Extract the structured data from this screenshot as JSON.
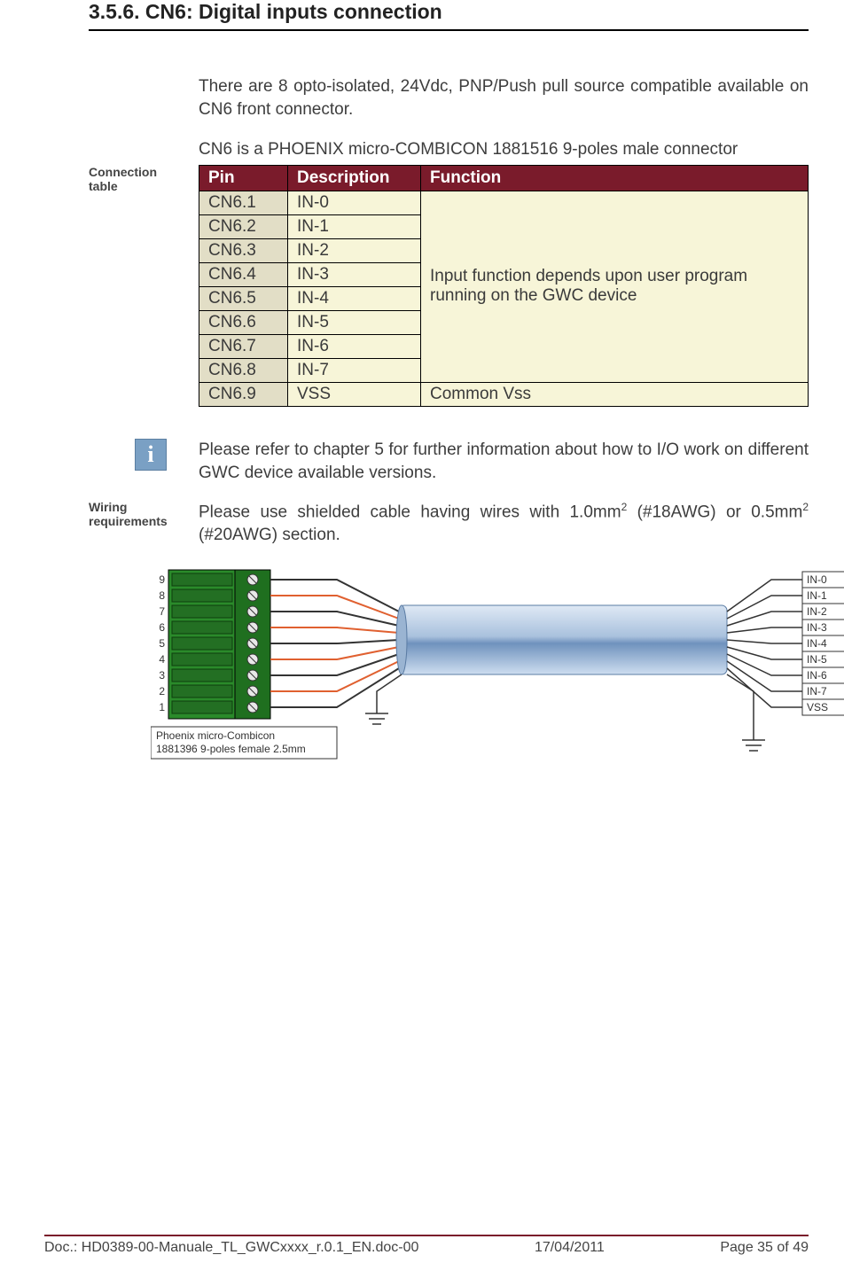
{
  "heading": "3.5.6. CN6: Digital inputs connection",
  "intro1": "There are 8 opto-isolated, 24Vdc, PNP/Push pull source compatible available on CN6 front connector.",
  "intro2": "CN6 is a PHOENIX micro-COMBICON 1881516 9-poles male connector",
  "label_connection": "Connection table",
  "table": {
    "h_pin": "Pin",
    "h_desc": "Description",
    "h_func": "Function",
    "rows": [
      {
        "pin": "CN6.1",
        "desc": "IN-0"
      },
      {
        "pin": "CN6.2",
        "desc": "IN-1"
      },
      {
        "pin": "CN6.3",
        "desc": "IN-2"
      },
      {
        "pin": "CN6.4",
        "desc": "IN-3"
      },
      {
        "pin": "CN6.5",
        "desc": "IN-4"
      },
      {
        "pin": "CN6.6",
        "desc": "IN-5"
      },
      {
        "pin": "CN6.7",
        "desc": "IN-6"
      },
      {
        "pin": "CN6.8",
        "desc": "IN-7"
      },
      {
        "pin": "CN6.9",
        "desc": "VSS"
      }
    ],
    "func_merged": "Input function depends upon user program running on the GWC device",
    "func_last": "Common Vss"
  },
  "info_text": "Please refer to chapter 5 for further information about how to I/O work on different GWC device available versions.",
  "label_wiring": "Wiring requirements",
  "wiring_pre": "Please use shielded cable having wires with 1.0mm",
  "wiring_mid": " (#18AWG) or 0.5mm",
  "wiring_post": " (#20AWG) section.",
  "diagram": {
    "pin_numbers": [
      "9",
      "8",
      "7",
      "6",
      "5",
      "4",
      "3",
      "2",
      "1"
    ],
    "signal_labels": [
      "IN-0",
      "IN-1",
      "IN-2",
      "IN-3",
      "IN-4",
      "IN-5",
      "IN-6",
      "IN-7",
      "VSS"
    ],
    "connector_note_l1": "Phoenix micro-Combicon",
    "connector_note_l2": "1881396 9-poles female 2.5mm"
  },
  "footer": {
    "doc": "Doc.: HD0389-00-Manuale_TL_GWCxxxx_r.0.1_EN.doc-00",
    "date": "17/04/2011",
    "page": "Page 35 of 49"
  }
}
